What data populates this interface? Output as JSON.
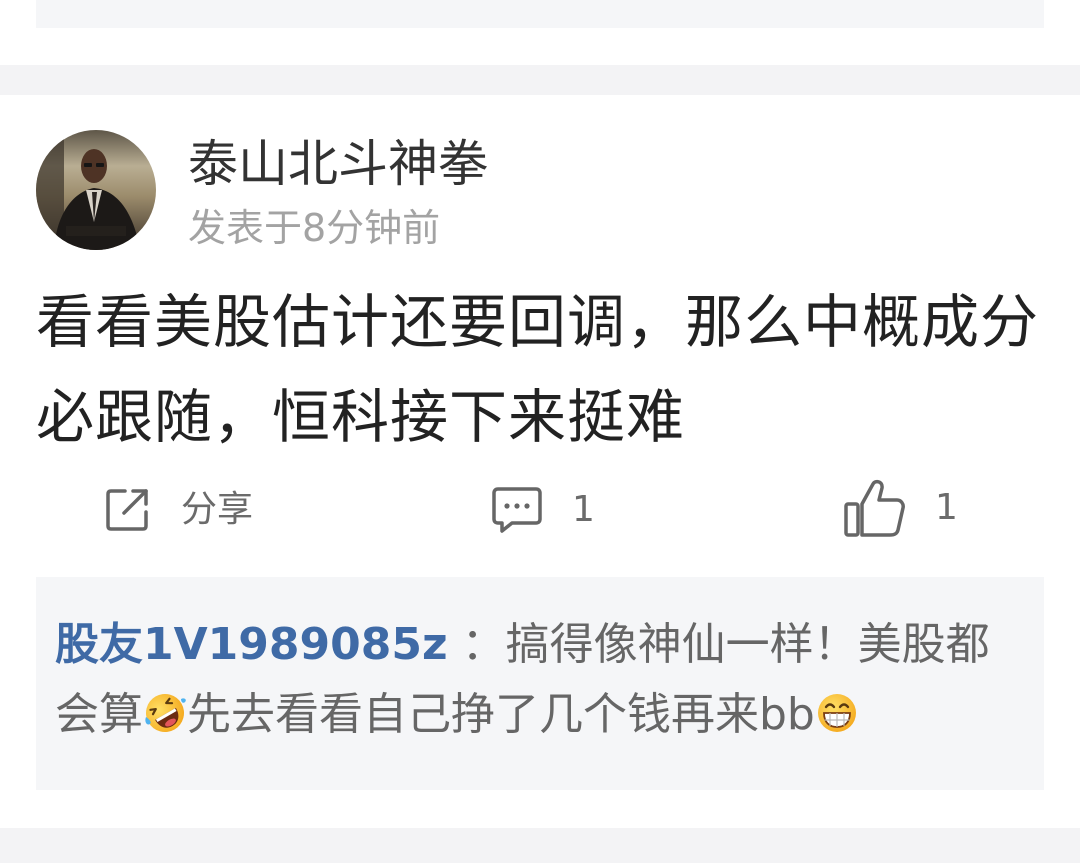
{
  "post": {
    "author": "泰山北斗神拳",
    "avatar_icon": "user-avatar",
    "time": "发表于8分钟前",
    "content_lines": [
      "看看美股估计还要回调，那么中概成分",
      "必跟随，恒科接下来挺难"
    ],
    "actions": {
      "share_icon": "share-icon",
      "share_label": "分享",
      "comment_icon": "comment-icon",
      "comment_count": "1",
      "like_icon": "thumbs-up-icon",
      "like_count": "1"
    },
    "reply": {
      "author": "股友1V1989085z",
      "line1_text": "：搞得像神仙一样！美股都",
      "line2_text_a": "会算",
      "emoji_1": "rolling-on-floor-laughing-emoji",
      "line2_text_b": "先去看看自己挣了几个钱再来bb",
      "emoji_2": "beaming-grin-emoji"
    }
  },
  "colors": {
    "panel": "#f5f6f8",
    "band": "#f3f3f5",
    "text": "#222222",
    "author": "#333333",
    "muted": "#a3a3a3",
    "action": "#6b6b6b",
    "link": "#3f6aa6",
    "reply_text": "#666666"
  }
}
